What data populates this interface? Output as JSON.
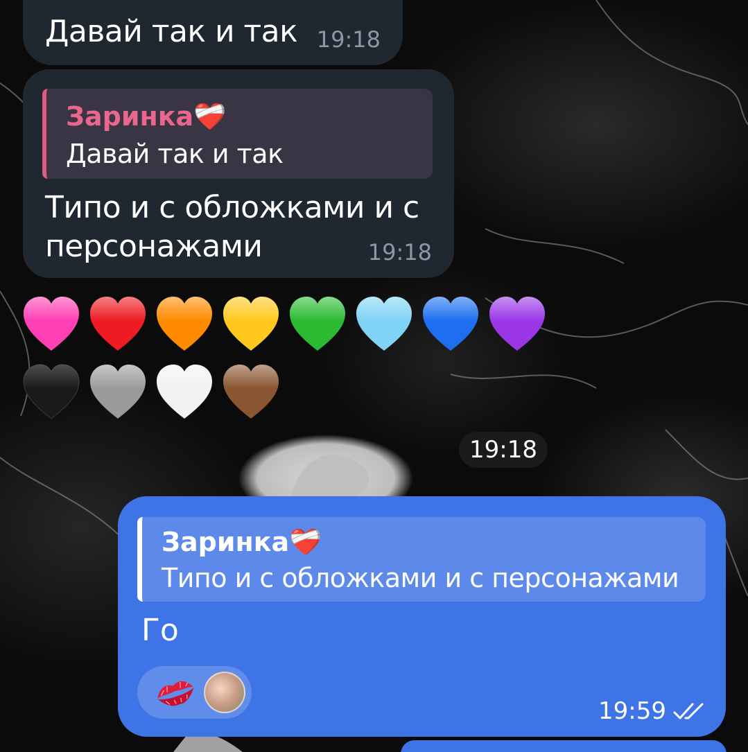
{
  "messages": [
    {
      "id": "m1",
      "direction": "incoming",
      "text": "Давай так и так",
      "time": "19:18"
    },
    {
      "id": "m2",
      "direction": "incoming",
      "reply_to": {
        "author": "Заринка❤️‍🩹",
        "text": "Давай так и так"
      },
      "text": "Типо и с обложками и с персонажами",
      "time": "19:18"
    },
    {
      "id": "m3",
      "direction": "incoming",
      "type": "emoji",
      "emoji": [
        "pink-heart",
        "red-heart",
        "orange-heart",
        "yellow-heart",
        "green-heart",
        "light-blue-heart",
        "blue-heart",
        "purple-heart",
        "black-heart",
        "grey-heart",
        "white-heart",
        "brown-heart"
      ],
      "time": "19:18"
    },
    {
      "id": "m4",
      "direction": "outgoing",
      "reply_to": {
        "author": "Заринка❤️‍🩹",
        "text": "Типо и с обложками и с персонажами"
      },
      "text": "Го",
      "reactions": [
        "kiss-mark",
        "user-avatar"
      ],
      "time": "19:59",
      "status": "read"
    }
  ],
  "colors": {
    "incoming_bubble": "#1f2731",
    "incoming_reply_bg": "#3a3545",
    "reply_name_pink": "#e9678f",
    "outgoing_bubble": "#3f74e6",
    "time_incoming": "#8b98a6"
  },
  "heart_colors": [
    "#ff3fb4",
    "#ee1b22",
    "#ff8a00",
    "#ffc81e",
    "#2bbb32",
    "#7fd3f5",
    "#1e6ff0",
    "#9b36e8",
    "#1a1a1a",
    "#9a9a9a",
    "#f2f2f2",
    "#8a5530"
  ]
}
